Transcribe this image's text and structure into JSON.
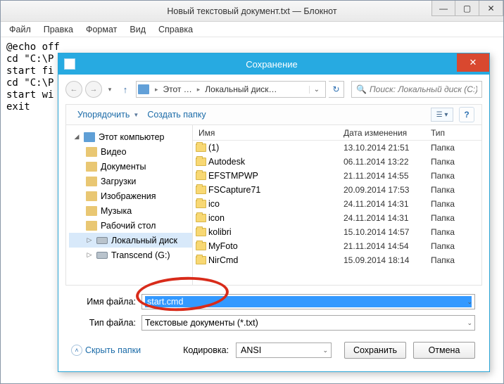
{
  "notepad": {
    "title": "Новый текстовый документ.txt — Блокнот",
    "menu": {
      "file": "Файл",
      "edit": "Правка",
      "format": "Формат",
      "view": "Вид",
      "help": "Справка"
    },
    "body": "@echo off\ncd \"C:\\P\nstart fi\ncd \"C:\\P\nstart wi\nexit"
  },
  "dialog": {
    "title": "Сохранение",
    "breadcrumb": {
      "c1": "Этот …",
      "c2": "Локальный диск…"
    },
    "search_placeholder": "Поиск: Локальный диск (C:)",
    "toolbar": {
      "organize": "Упорядочить",
      "newfolder": "Создать папку"
    },
    "columns": {
      "name": "Имя",
      "date": "Дата изменения",
      "type": "Тип"
    },
    "sidebar": {
      "this_pc": "Этот компьютер",
      "items": [
        {
          "label": "Видео"
        },
        {
          "label": "Документы"
        },
        {
          "label": "Загрузки"
        },
        {
          "label": "Изображения"
        },
        {
          "label": "Музыка"
        },
        {
          "label": "Рабочий стол"
        },
        {
          "label": "Локальный диск"
        },
        {
          "label": "Transcend (G:)"
        }
      ]
    },
    "files": [
      {
        "name": "(1)",
        "date": "13.10.2014 21:51",
        "type": "Папка"
      },
      {
        "name": "Autodesk",
        "date": "06.11.2014 13:22",
        "type": "Папка"
      },
      {
        "name": "EFSTMPWP",
        "date": "21.11.2014 14:55",
        "type": "Папка"
      },
      {
        "name": "FSCapture71",
        "date": "20.09.2014 17:53",
        "type": "Папка"
      },
      {
        "name": "ico",
        "date": "24.11.2014 14:31",
        "type": "Папка"
      },
      {
        "name": "icon",
        "date": "24.11.2014 14:31",
        "type": "Папка"
      },
      {
        "name": "kolibri",
        "date": "15.10.2014 14:57",
        "type": "Папка"
      },
      {
        "name": "MyFoto",
        "date": "21.11.2014 14:54",
        "type": "Папка"
      },
      {
        "name": "NirCmd",
        "date": "15.09.2014 18:14",
        "type": "Папка"
      }
    ],
    "form": {
      "filename_label": "Имя файла:",
      "filename_value": "start.cmd",
      "filetype_label": "Тип файла:",
      "filetype_value": "Текстовые документы (*.txt)",
      "encoding_label": "Кодировка:",
      "encoding_value": "ANSI",
      "hide_folders": "Скрыть папки",
      "save": "Сохранить",
      "cancel": "Отмена"
    }
  }
}
